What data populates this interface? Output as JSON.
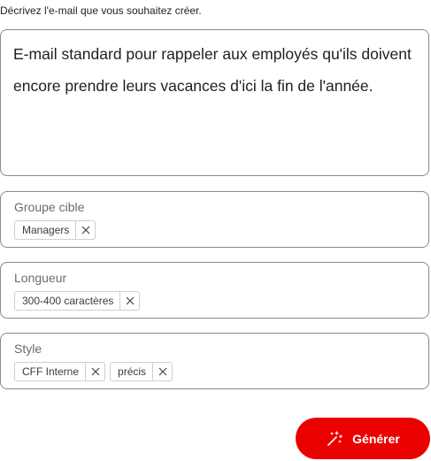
{
  "instruction": "Décrivez l'e-mail que vous souhaitez créer.",
  "description": {
    "value": "E-mail standard pour rappeler aux employés qu'ils doivent encore prendre leurs vacances d'ici la fin de l'année."
  },
  "fields": {
    "target_group": {
      "label": "Groupe cible",
      "chips": [
        "Managers"
      ]
    },
    "length": {
      "label": "Longueur",
      "chips": [
        "300-400 caractères"
      ]
    },
    "style": {
      "label": "Style",
      "chips": [
        "CFF Interne",
        "précis"
      ]
    }
  },
  "generate_button": {
    "label": "Générer",
    "icon": "magic-wand-icon",
    "color": "#eb0000"
  },
  "colors": {
    "border": "#8a8a8a",
    "chip_border": "#cfcfcf",
    "label": "#6b6b6b"
  }
}
